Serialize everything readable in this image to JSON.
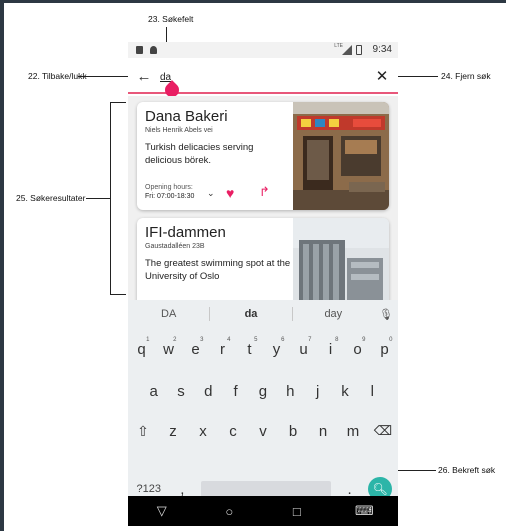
{
  "annotations": {
    "search_field": "23. Søkefelt",
    "back_close": "22. Tilbake/lukk",
    "clear_search": "24. Fjern søk",
    "search_results": "25. Søkeresultater",
    "confirm_search": "26. Bekreft søk"
  },
  "status_bar": {
    "time": "9:34",
    "network": "LTE"
  },
  "search": {
    "query": "da",
    "back_icon": "arrow-left-icon",
    "clear_icon": "close-icon",
    "accent_color": "#e8577a"
  },
  "results": [
    {
      "title": "Dana Bakeri",
      "address": "Niels Henrik Abels vei",
      "description": "Turkish delicacies serving delicious börek.",
      "hours_label": "Opening hours:",
      "hours": "Fri: 07:00-18:30"
    },
    {
      "title": "IFI-dammen",
      "address": "Gaustadalléen 23B",
      "description": "The greatest swimming spot at the University of Oslo"
    }
  ],
  "keyboard": {
    "suggestions": [
      "DA",
      "da",
      "day"
    ],
    "rows": [
      [
        {
          "k": "q",
          "n": "1"
        },
        {
          "k": "w",
          "n": "2"
        },
        {
          "k": "e",
          "n": "3"
        },
        {
          "k": "r",
          "n": "4"
        },
        {
          "k": "t",
          "n": "5"
        },
        {
          "k": "y",
          "n": "6"
        },
        {
          "k": "u",
          "n": "7"
        },
        {
          "k": "i",
          "n": "8"
        },
        {
          "k": "o",
          "n": "9"
        },
        {
          "k": "p",
          "n": "0"
        }
      ],
      [
        {
          "k": "a"
        },
        {
          "k": "s"
        },
        {
          "k": "d"
        },
        {
          "k": "f"
        },
        {
          "k": "g"
        },
        {
          "k": "h"
        },
        {
          "k": "j"
        },
        {
          "k": "k"
        },
        {
          "k": "l"
        }
      ],
      [
        {
          "k": "z"
        },
        {
          "k": "x"
        },
        {
          "k": "c"
        },
        {
          "k": "v"
        },
        {
          "k": "b"
        },
        {
          "k": "n"
        },
        {
          "k": "m"
        }
      ]
    ],
    "symbols_key": "?123",
    "comma_key": ",",
    "period_key": ".",
    "enter_color": "#2cb5a8"
  },
  "navbar": {
    "back": "▽",
    "home": "○",
    "recents": "□",
    "keyboard": "⌨"
  }
}
